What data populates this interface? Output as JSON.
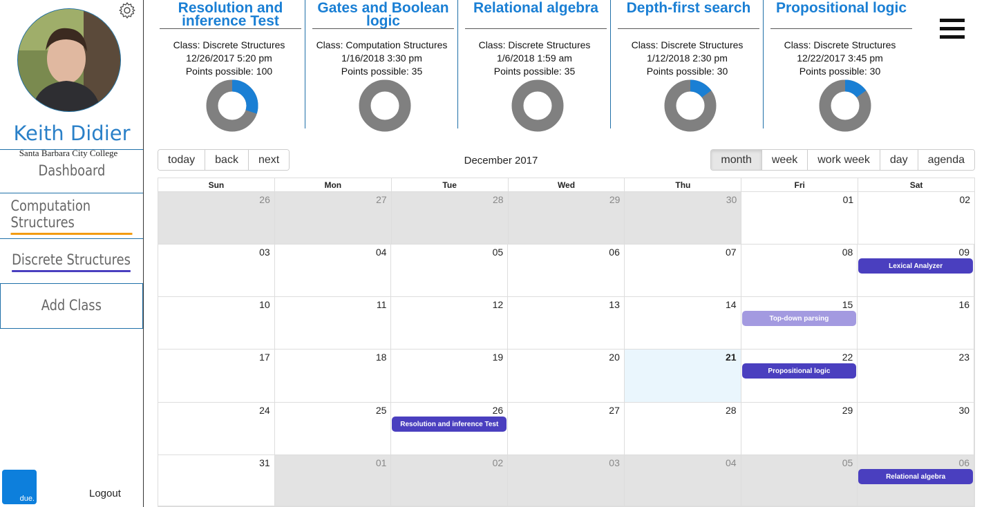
{
  "user": {
    "name": "Keith Didier",
    "college": "Santa Barbara City College"
  },
  "nav": {
    "dashboard": "Dashboard",
    "computation": "Computation Structures",
    "discrete": "Discrete Structures",
    "add_class": "Add Class"
  },
  "footer": {
    "logo_text": "due.",
    "logout": "Logout"
  },
  "colors": {
    "brand": "#1a7fd4",
    "computation_underline": "#f39c12",
    "discrete_event": "#4a3fbf",
    "donut_progress": "#1a7fd4",
    "donut_remaining": "#808080"
  },
  "assignments": [
    {
      "title": "Resolution and inference Test",
      "class_line": "Class: Discrete Structures",
      "due": "12/26/2017 5:20 pm",
      "points": "Points possible: 100",
      "progress": 0.3
    },
    {
      "title": "Gates and Boolean logic",
      "class_line": "Class: Computation Structures",
      "due": "1/16/2018 3:30 pm",
      "points": "Points possible: 35",
      "progress": 0.0
    },
    {
      "title": "Relational algebra",
      "class_line": "Class: Discrete Structures",
      "due": "1/6/2018 1:59 am",
      "points": "Points possible: 35",
      "progress": 0.0
    },
    {
      "title": "Depth-first search",
      "class_line": "Class: Discrete Structures",
      "due": "1/12/2018 2:30 pm",
      "points": "Points possible: 30",
      "progress": 0.15
    },
    {
      "title": "Propositional logic",
      "class_line": "Class: Discrete Structures",
      "due": "12/22/2017 3:45 pm",
      "points": "Points possible: 30",
      "progress": 0.15
    }
  ],
  "calendar": {
    "title": "December 2017",
    "nav_buttons": [
      "today",
      "back",
      "next"
    ],
    "views": [
      "month",
      "week",
      "work week",
      "day",
      "agenda"
    ],
    "active_view": "month",
    "weekdays": [
      "Sun",
      "Mon",
      "Tue",
      "Wed",
      "Thu",
      "Fri",
      "Sat"
    ],
    "weeks": [
      [
        {
          "d": "26",
          "off": true
        },
        {
          "d": "27",
          "off": true
        },
        {
          "d": "28",
          "off": true
        },
        {
          "d": "29",
          "off": true
        },
        {
          "d": "30",
          "off": true
        },
        {
          "d": "01"
        },
        {
          "d": "02"
        }
      ],
      [
        {
          "d": "03"
        },
        {
          "d": "04"
        },
        {
          "d": "05"
        },
        {
          "d": "06"
        },
        {
          "d": "07"
        },
        {
          "d": "08"
        },
        {
          "d": "09"
        }
      ],
      [
        {
          "d": "10"
        },
        {
          "d": "11"
        },
        {
          "d": "12"
        },
        {
          "d": "13"
        },
        {
          "d": "14"
        },
        {
          "d": "15"
        },
        {
          "d": "16"
        }
      ],
      [
        {
          "d": "17"
        },
        {
          "d": "18"
        },
        {
          "d": "19"
        },
        {
          "d": "20"
        },
        {
          "d": "21",
          "today": true
        },
        {
          "d": "22"
        },
        {
          "d": "23"
        }
      ],
      [
        {
          "d": "24"
        },
        {
          "d": "25"
        },
        {
          "d": "26"
        },
        {
          "d": "27"
        },
        {
          "d": "28"
        },
        {
          "d": "29"
        },
        {
          "d": "30"
        }
      ],
      [
        {
          "d": "31"
        },
        {
          "d": "01",
          "off": true
        },
        {
          "d": "02",
          "off": true
        },
        {
          "d": "03",
          "off": true
        },
        {
          "d": "04",
          "off": true
        },
        {
          "d": "05",
          "off": true
        },
        {
          "d": "06",
          "off": true
        }
      ]
    ],
    "events": [
      {
        "label": "Lexical Analyzer",
        "week": 1,
        "day": 6
      },
      {
        "label": "Top-down parsing",
        "week": 2,
        "day": 5,
        "light": true
      },
      {
        "label": "Propositional logic",
        "week": 3,
        "day": 5
      },
      {
        "label": "Resolution and inference Test",
        "week": 4,
        "day": 2
      },
      {
        "label": "Relational algebra",
        "week": 5,
        "day": 6
      }
    ]
  }
}
